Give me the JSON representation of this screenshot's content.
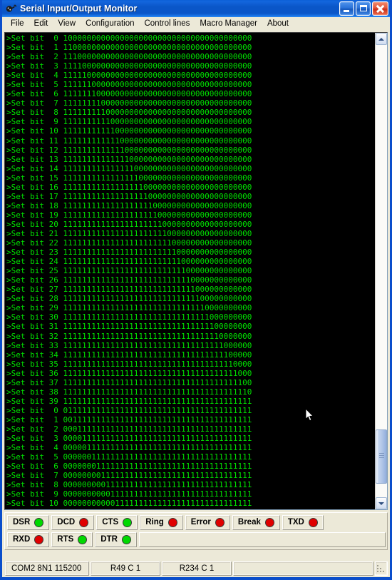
{
  "window": {
    "title": "Serial Input/Output Monitor",
    "icon": "serial-plug-icon",
    "accent_color": "#0a56c8",
    "face_color": "#ece9d8"
  },
  "titlebar_buttons": [
    {
      "name": "minimize",
      "glyph": "minimize-icon"
    },
    {
      "name": "maximize",
      "glyph": "maximize-icon"
    },
    {
      "name": "close",
      "glyph": "close-icon"
    }
  ],
  "menubar": {
    "items": [
      {
        "label": "File"
      },
      {
        "label": "Edit"
      },
      {
        "label": "View"
      },
      {
        "label": "Configuration"
      },
      {
        "label": "Control lines"
      },
      {
        "label": "Macro Manager"
      },
      {
        "label": "About"
      }
    ]
  },
  "terminal": {
    "text_color": "#00e000",
    "background_color": "#000000",
    "prompt": ">",
    "command": "Set bit",
    "word_width": 40,
    "lines": [
      ">Set bit  0 1000000000000000000000000000000000000000",
      ">Set bit  1 1100000000000000000000000000000000000000",
      ">Set bit  2 1110000000000000000000000000000000000000",
      ">Set bit  3 1111000000000000000000000000000000000000",
      ">Set bit  4 1111100000000000000000000000000000000000",
      ">Set bit  5 1111110000000000000000000000000000000000",
      ">Set bit  6 1111111000000000000000000000000000000000",
      ">Set bit  7 1111111100000000000000000000000000000000",
      ">Set bit  8 1111111110000000000000000000000000000000",
      ">Set bit  9 1111111111000000000000000000000000000000",
      ">Set bit 10 1111111111100000000000000000000000000000",
      ">Set bit 11 1111111111110000000000000000000000000000",
      ">Set bit 12 1111111111111000000000000000000000000000",
      ">Set bit 13 1111111111111100000000000000000000000000",
      ">Set bit 14 1111111111111110000000000000000000000000",
      ">Set bit 15 1111111111111111000000000000000000000000",
      ">Set bit 16 1111111111111111100000000000000000000000",
      ">Set bit 17 1111111111111111110000000000000000000000",
      ">Set bit 18 1111111111111111111000000000000000000000",
      ">Set bit 19 1111111111111111111100000000000000000000",
      ">Set bit 20 1111111111111111111110000000000000000000",
      ">Set bit 21 1111111111111111111111000000000000000000",
      ">Set bit 22 1111111111111111111111100000000000000000",
      ">Set bit 23 1111111111111111111111110000000000000000",
      ">Set bit 24 1111111111111111111111111000000000000000",
      ">Set bit 25 1111111111111111111111111100000000000000",
      ">Set bit 26 1111111111111111111111111110000000000000",
      ">Set bit 27 1111111111111111111111111111000000000000",
      ">Set bit 28 1111111111111111111111111111100000000000",
      ">Set bit 29 1111111111111111111111111111110000000000",
      ">Set bit 30 1111111111111111111111111111111000000000",
      ">Set bit 31 1111111111111111111111111111111100000000",
      ">Set bit 32 1111111111111111111111111111111110000000",
      ">Set bit 33 1111111111111111111111111111111111000000",
      ">Set bit 34 1111111111111111111111111111111111100000",
      ">Set bit 35 1111111111111111111111111111111111110000",
      ">Set bit 36 1111111111111111111111111111111111111000",
      ">Set bit 37 1111111111111111111111111111111111111100",
      ">Set bit 38 1111111111111111111111111111111111111110",
      ">Set bit 39 1111111111111111111111111111111111111111",
      ">Set bit  0 0111111111111111111111111111111111111111",
      ">Set bit  1 0011111111111111111111111111111111111111",
      ">Set bit  2 0001111111111111111111111111111111111111",
      ">Set bit  3 0000111111111111111111111111111111111111",
      ">Set bit  4 0000011111111111111111111111111111111111",
      ">Set bit  5 0000001111111111111111111111111111111111",
      ">Set bit  6 0000000111111111111111111111111111111111",
      ">Set bit  7 0000000011111111111111111111111111111111",
      ">Set bit  8 0000000001111111111111111111111111111111",
      ">Set bit  9 0000000000111111111111111111111111111111",
      ">Set bit 10 0000000000011111111111111111111111111111"
    ]
  },
  "scrollbar": {
    "up_arrow": "chevron-up-icon",
    "down_arrow": "chevron-down-icon",
    "thumb_top_pct": 85,
    "thumb_height_pct": 12
  },
  "control_lines": {
    "on_color": "#00d800",
    "off_color": "#e00000",
    "rows": [
      [
        {
          "label": "DSR",
          "state": "on"
        },
        {
          "label": "DCD",
          "state": "off"
        },
        {
          "label": "CTS",
          "state": "on"
        },
        {
          "label": "Ring",
          "state": "off"
        },
        {
          "label": "Error",
          "state": "off"
        },
        {
          "label": "Break",
          "state": "off"
        },
        {
          "label": "TXD",
          "state": "off"
        }
      ],
      [
        {
          "label": "RXD",
          "state": "off"
        },
        {
          "label": "RTS",
          "state": "on"
        },
        {
          "label": "DTR",
          "state": "on"
        }
      ]
    ]
  },
  "statusbar": {
    "port_settings": "COM2 8N1 115200",
    "cursor_in": "R49 C 1",
    "cursor_out": "R234 C 1",
    "spare": "",
    "grip": "resize-grip"
  }
}
